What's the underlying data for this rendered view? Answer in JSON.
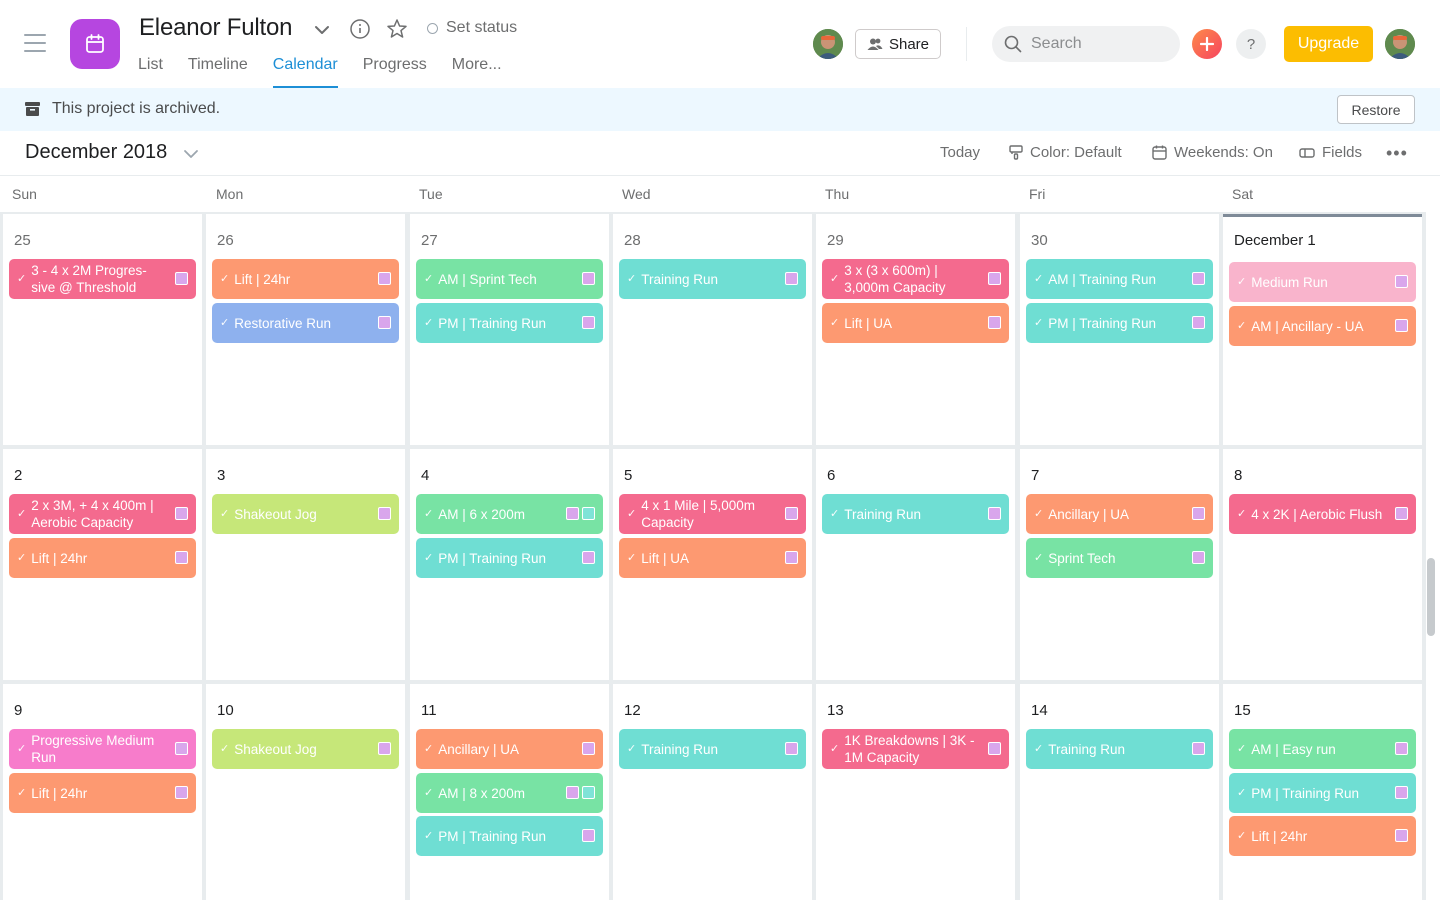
{
  "header": {
    "project_title": "Eleanor Fulton",
    "set_status_label": "Set status",
    "tabs": [
      {
        "label": "List"
      },
      {
        "label": "Timeline"
      },
      {
        "label": "Calendar",
        "active": true
      },
      {
        "label": "Progress"
      },
      {
        "label": "More..."
      }
    ],
    "share_label": "Share",
    "search_placeholder": "Search",
    "help_label": "?",
    "upgrade_label": "Upgrade",
    "project_color": "#b646e0",
    "upgrade_color": "#fcbd01"
  },
  "banner": {
    "text": "This project is archived.",
    "restore_label": "Restore"
  },
  "toolbar": {
    "month": "December 2018",
    "today": "Today",
    "color": "Color: Default",
    "weekends": "Weekends: On",
    "fields": "Fields",
    "more": "•••"
  },
  "days_of_week": [
    "Sun",
    "Mon",
    "Tue",
    "Wed",
    "Thu",
    "Fri",
    "Sat"
  ],
  "weeks": [
    [
      {
        "day": "25",
        "tasks": [
          {
            "title": "3 - 4 x 2M Progres-sive @ Threshold",
            "color": "pink"
          }
        ]
      },
      {
        "day": "26",
        "tasks": [
          {
            "title": "Lift | 24hr",
            "color": "orange"
          },
          {
            "title": "Restorative Run",
            "color": "blue"
          }
        ]
      },
      {
        "day": "27",
        "tasks": [
          {
            "title": "AM | Sprint Tech",
            "color": "green"
          },
          {
            "title": "PM | Training Run",
            "color": "teal"
          }
        ]
      },
      {
        "day": "28",
        "tasks": [
          {
            "title": "Training Run",
            "color": "teal"
          }
        ]
      },
      {
        "day": "29",
        "tasks": [
          {
            "title": "3 x (3 x 600m) | 3,000m Capacity",
            "color": "pink"
          },
          {
            "title": "Lift | UA",
            "color": "orange"
          }
        ]
      },
      {
        "day": "30",
        "tasks": [
          {
            "title": "AM | Training Run",
            "color": "teal"
          },
          {
            "title": "PM | Training Run",
            "color": "teal"
          }
        ]
      },
      {
        "day": "December 1",
        "today": true,
        "tasks": [
          {
            "title": "Medium Run",
            "color": "lightpink"
          },
          {
            "title": "AM | Ancillary - UA",
            "color": "orange"
          }
        ]
      }
    ],
    [
      {
        "day": "2",
        "tasks": [
          {
            "title": "2 x 3M, + 4 x 400m | Aerobic Capacity",
            "color": "pink"
          },
          {
            "title": "Lift | 24hr",
            "color": "orange"
          }
        ]
      },
      {
        "day": "3",
        "tasks": [
          {
            "title": "Shakeout Jog",
            "color": "lime"
          }
        ]
      },
      {
        "day": "4",
        "tasks": [
          {
            "title": "AM | 6 x 200m",
            "color": "green",
            "double": true
          },
          {
            "title": "PM | Training Run",
            "color": "teal"
          }
        ]
      },
      {
        "day": "5",
        "tasks": [
          {
            "title": "4 x 1 Mile | 5,000m Capacity",
            "color": "pink"
          },
          {
            "title": "Lift | UA",
            "color": "orange"
          }
        ]
      },
      {
        "day": "6",
        "tasks": [
          {
            "title": "Training Run",
            "color": "teal"
          }
        ]
      },
      {
        "day": "7",
        "tasks": [
          {
            "title": "Ancillary | UA",
            "color": "orange"
          },
          {
            "title": "Sprint Tech",
            "color": "green"
          }
        ]
      },
      {
        "day": "8",
        "tasks": [
          {
            "title": "4 x 2K | Aerobic Flush",
            "color": "pink"
          }
        ]
      }
    ],
    [
      {
        "day": "9",
        "tasks": [
          {
            "title": "Progressive Medium Run",
            "color": "magenta"
          },
          {
            "title": "Lift | 24hr",
            "color": "orange"
          }
        ]
      },
      {
        "day": "10",
        "tasks": [
          {
            "title": "Shakeout Jog",
            "color": "lime"
          }
        ]
      },
      {
        "day": "11",
        "tasks": [
          {
            "title": "Ancillary | UA",
            "color": "orange"
          },
          {
            "title": "AM | 8 x 200m",
            "color": "green",
            "double": true
          },
          {
            "title": "PM | Training Run",
            "color": "teal"
          }
        ]
      },
      {
        "day": "12",
        "tasks": [
          {
            "title": "Training Run",
            "color": "teal"
          }
        ]
      },
      {
        "day": "13",
        "tasks": [
          {
            "title": "1K Breakdowns | 3K - 1M Capacity",
            "color": "pink"
          }
        ]
      },
      {
        "day": "14",
        "tasks": [
          {
            "title": "Training Run",
            "color": "teal"
          }
        ]
      },
      {
        "day": "15",
        "tasks": [
          {
            "title": "AM | Easy run",
            "color": "green"
          },
          {
            "title": "PM | Training Run",
            "color": "teal"
          },
          {
            "title": "Lift | 24hr",
            "color": "orange"
          }
        ]
      }
    ]
  ]
}
